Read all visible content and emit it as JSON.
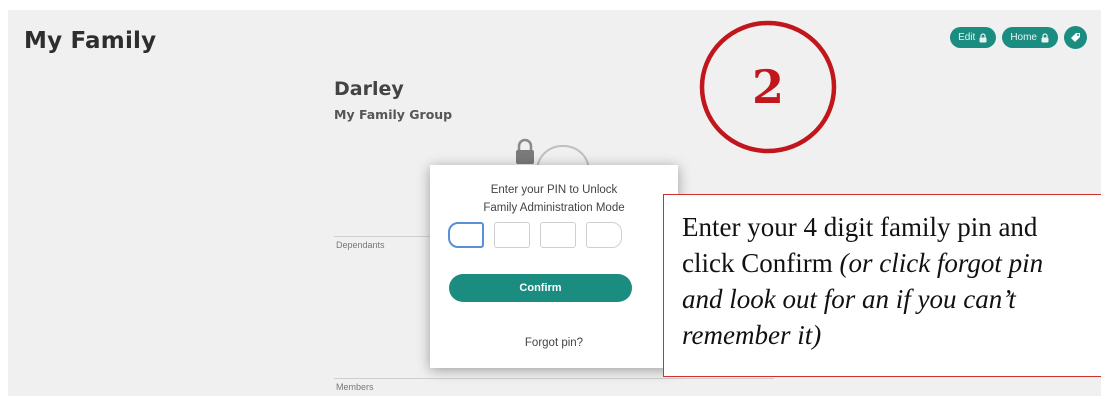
{
  "header": {
    "title": "My Family",
    "buttons": {
      "edit": "Edit",
      "home": "Home"
    }
  },
  "group": {
    "name": "Darley",
    "subtitle": "My Family Group"
  },
  "sections": {
    "dependants": "Dependants",
    "members": "Members"
  },
  "pin_modal": {
    "prompt": "Enter your PIN to Unlock\nFamily Administration Mode",
    "pin_digits": [
      "",
      "",
      "",
      ""
    ],
    "confirm_label": "Confirm",
    "forgot_label": "Forgot pin?"
  },
  "annotation": {
    "step_number": "2",
    "text_main": "Enter your 4 digit family pin and click Confirm ",
    "text_italic": "(or click forgot pin and look out for an if you can’t remember it)"
  },
  "colors": {
    "accent": "#1a8c80",
    "annotation_red": "#c0161c",
    "focus_blue": "#5b8fd6"
  }
}
